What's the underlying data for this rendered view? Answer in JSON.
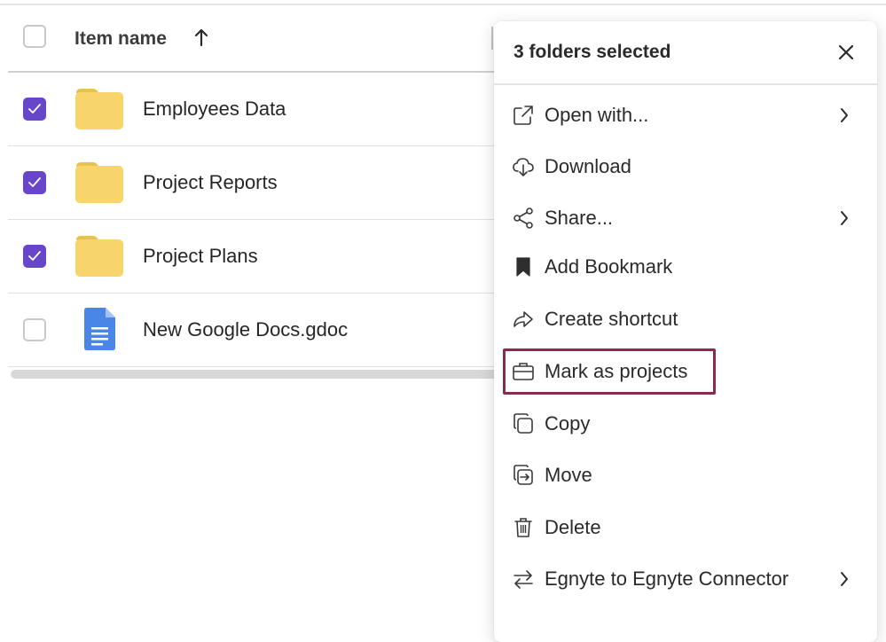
{
  "file_list": {
    "column_header": "Item name",
    "rows": [
      {
        "name": "Employees Data",
        "type": "folder",
        "checked": true
      },
      {
        "name": "Project Reports",
        "type": "folder",
        "checked": true
      },
      {
        "name": "Project Plans",
        "type": "folder",
        "checked": true
      },
      {
        "name": "New Google Docs.gdoc",
        "type": "gdoc",
        "checked": false
      }
    ]
  },
  "menu": {
    "title": "3 folders selected",
    "items": [
      {
        "label": "Open with...",
        "icon": "external-link-icon",
        "submenu": true
      },
      {
        "label": "Download",
        "icon": "cloud-download-icon",
        "submenu": false
      },
      {
        "label": "Share...",
        "icon": "share-icon",
        "submenu": true
      },
      {
        "label": "Add Bookmark",
        "icon": "bookmark-icon",
        "submenu": false
      },
      {
        "label": "Create shortcut",
        "icon": "shortcut-arrow-icon",
        "submenu": false
      },
      {
        "label": "Mark as projects",
        "icon": "briefcase-icon",
        "submenu": false,
        "highlighted": true
      },
      {
        "label": "Copy",
        "icon": "copy-icon",
        "submenu": false
      },
      {
        "label": "Move",
        "icon": "move-icon",
        "submenu": false
      },
      {
        "label": "Delete",
        "icon": "trash-icon",
        "submenu": false
      },
      {
        "label": "Egnyte to Egnyte Connector",
        "icon": "swap-arrows-icon",
        "submenu": true
      }
    ]
  },
  "colors": {
    "checkbox_checked": "#6846c9",
    "folder": "#f7d56b",
    "gdoc": "#4a86e8",
    "highlight_border": "#8a2a4e"
  }
}
